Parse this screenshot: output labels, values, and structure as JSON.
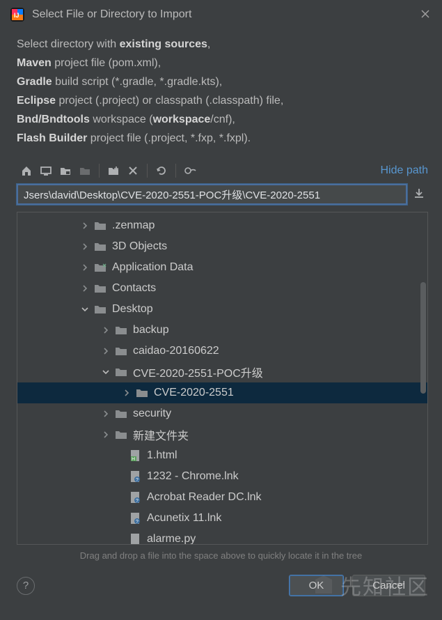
{
  "dialog": {
    "title": "Select File or Directory to Import"
  },
  "description": {
    "line1_a": "Select directory with ",
    "line1_b": "existing sources",
    "line1_c": ",",
    "line2_a": "Maven",
    "line2_b": " project file (pom.xml),",
    "line3_a": "Gradle",
    "line3_b": " build script (*.gradle, *.gradle.kts),",
    "line4_a": "Eclipse",
    "line4_b": " project (.project) or classpath (.classpath) file,",
    "line5_a": "Bnd/Bndtools",
    "line5_b": " workspace (",
    "line5_c": "workspace",
    "line5_d": "/cnf),",
    "line6_a": "Flash Builder",
    "line6_b": " project file (.project, *.fxp, *.fxpl)."
  },
  "toolbar": {
    "hide_path": "Hide path"
  },
  "path": {
    "value": "Jsers\\david\\Desktop\\CVE-2020-2551-POC升级\\CVE-2020-2551"
  },
  "tree": {
    "items": [
      {
        "indent": 90,
        "arrow": "right",
        "type": "folder",
        "label": ".zenmap",
        "selected": false
      },
      {
        "indent": 90,
        "arrow": "right",
        "type": "folder",
        "label": "3D Objects",
        "selected": false
      },
      {
        "indent": 90,
        "arrow": "right",
        "type": "folder-link",
        "label": "Application Data",
        "selected": false
      },
      {
        "indent": 90,
        "arrow": "right",
        "type": "folder",
        "label": "Contacts",
        "selected": false
      },
      {
        "indent": 90,
        "arrow": "down",
        "type": "folder",
        "label": "Desktop",
        "selected": false
      },
      {
        "indent": 120,
        "arrow": "right",
        "type": "folder",
        "label": "backup",
        "selected": false
      },
      {
        "indent": 120,
        "arrow": "right",
        "type": "folder",
        "label": "caidao-20160622",
        "selected": false
      },
      {
        "indent": 120,
        "arrow": "down",
        "type": "folder",
        "label": "CVE-2020-2551-POC升级",
        "selected": false
      },
      {
        "indent": 150,
        "arrow": "right",
        "type": "folder",
        "label": "CVE-2020-2551",
        "selected": true
      },
      {
        "indent": 120,
        "arrow": "right",
        "type": "folder",
        "label": "security",
        "selected": false
      },
      {
        "indent": 120,
        "arrow": "right",
        "type": "folder",
        "label": "新建文件夹",
        "selected": false
      },
      {
        "indent": 140,
        "arrow": "none",
        "type": "html",
        "label": "1.html",
        "selected": false
      },
      {
        "indent": 140,
        "arrow": "none",
        "type": "lnk",
        "label": "1232 - Chrome.lnk",
        "selected": false
      },
      {
        "indent": 140,
        "arrow": "none",
        "type": "lnk",
        "label": "Acrobat Reader DC.lnk",
        "selected": false
      },
      {
        "indent": 140,
        "arrow": "none",
        "type": "lnk",
        "label": "Acunetix 11.lnk",
        "selected": false
      },
      {
        "indent": 140,
        "arrow": "none",
        "type": "file",
        "label": "alarme.py",
        "selected": false
      }
    ]
  },
  "hint": "Drag and drop a file into the space above to quickly locate it in the tree",
  "footer": {
    "ok": "OK",
    "cancel": "Cancel"
  },
  "watermark": "先知社区"
}
